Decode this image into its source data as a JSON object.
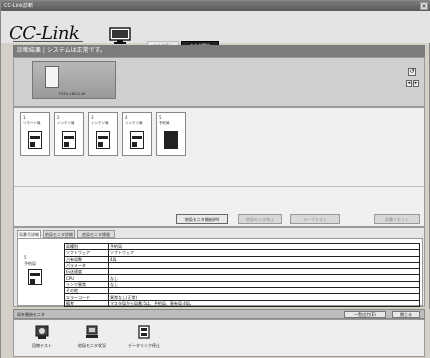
{
  "window": {
    "title": "CC-Link診断",
    "close_glyph": "✕"
  },
  "header": {
    "logo_text": "CC-Link",
    "monitor_label": "モニタ中",
    "btn_1_label": "モニタ停止",
    "btn_2_label": "モニタ開始"
  },
  "status": {
    "text": "診断結果 | システムは正常です。"
  },
  "station_panel": {
    "thumb_label": "FX3U-16CCL-M",
    "refresh_glyph": "↺",
    "scroll_left_glyph": "◂",
    "scroll_right_glyph": "▸"
  },
  "network": {
    "stations": [
      {
        "num": "1",
        "name": "リモート局"
      },
      {
        "num": "2",
        "name": "インテリ局"
      },
      {
        "num": "3",
        "name": "インテリ局"
      },
      {
        "num": "4",
        "name": "インテリ局"
      },
      {
        "num": "5",
        "name": "予約局"
      }
    ],
    "buttons": {
      "monitor_start": "他局モニタ開始(M)",
      "monitor_stop": "他局モニタ停止",
      "loop_test": "ループテスト",
      "reset": "局番リセット"
    }
  },
  "detail": {
    "tabs": [
      "局番号詳細",
      "他局モニタ詳細",
      "他局モニタ情報"
    ],
    "station_num": "5",
    "station_name": "予約局",
    "rows": [
      {
        "k": "局種別",
        "v": "予約局"
      },
      {
        "k": "ソフトウェア",
        "v": "ソフトウェア"
      },
      {
        "k": "占有局数",
        "v": "4局"
      },
      {
        "k": "パラメータ",
        "v": ""
      },
      {
        "k": "伝送速度",
        "v": ""
      },
      {
        "k": "CPU",
        "v": "なし"
      },
      {
        "k": "リンク異常",
        "v": "なし"
      },
      {
        "k": "その他",
        "v": ""
      },
      {
        "k": "エラーコード",
        "v": "異常なし(正常)"
      },
      {
        "k": "備考",
        "v": "マスタ局から局番:5は、予約局、専有局:4局。"
      }
    ]
  },
  "footer": {
    "title": "局を開始モニタ",
    "list_output": "一覧出力(E)",
    "close": "閉じる",
    "tools": [
      "回線テスト",
      "他局モニタ状況",
      "データリンク停止"
    ]
  }
}
